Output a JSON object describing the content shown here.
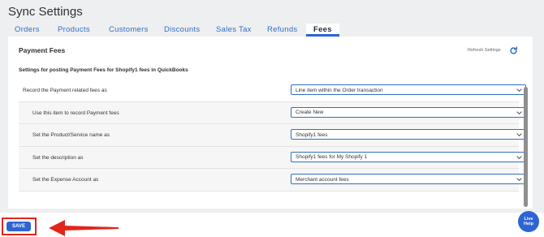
{
  "page": {
    "title": "Sync Settings"
  },
  "tabs": [
    {
      "label": "Orders"
    },
    {
      "label": "Products"
    },
    {
      "label": "Customers"
    },
    {
      "label": "Discounts"
    },
    {
      "label": "Sales Tax"
    },
    {
      "label": "Refunds"
    },
    {
      "label": "Fees",
      "active": true
    }
  ],
  "card": {
    "title": "Payment Fees",
    "refresh_label": "Refresh Settings",
    "refresh_icon": "refresh-icon",
    "subtitle": "Settings for posting Payment Fees for Shopify1 fees in QuickBooks"
  },
  "settings": [
    {
      "label": "Record the Payment related fees as",
      "value": "Line item within the Order transaction"
    },
    {
      "label": "Use this item to record Payment fees",
      "value": "Create New"
    },
    {
      "label": "Set the Product/Service name as",
      "value": "Shopify1 fees"
    },
    {
      "label": "Set the description as",
      "value": "Shopify1 fees for My Shopify 1"
    },
    {
      "label": "Set the Expense Account as",
      "value": "Merchant account fees"
    }
  ],
  "footer": {
    "save_label": "SAVE"
  },
  "live_help": {
    "line1": "Live",
    "line2": "Help"
  },
  "colors": {
    "accent": "#2e64d3",
    "link": "#2f6fc4",
    "annotation": "#e0261a"
  }
}
